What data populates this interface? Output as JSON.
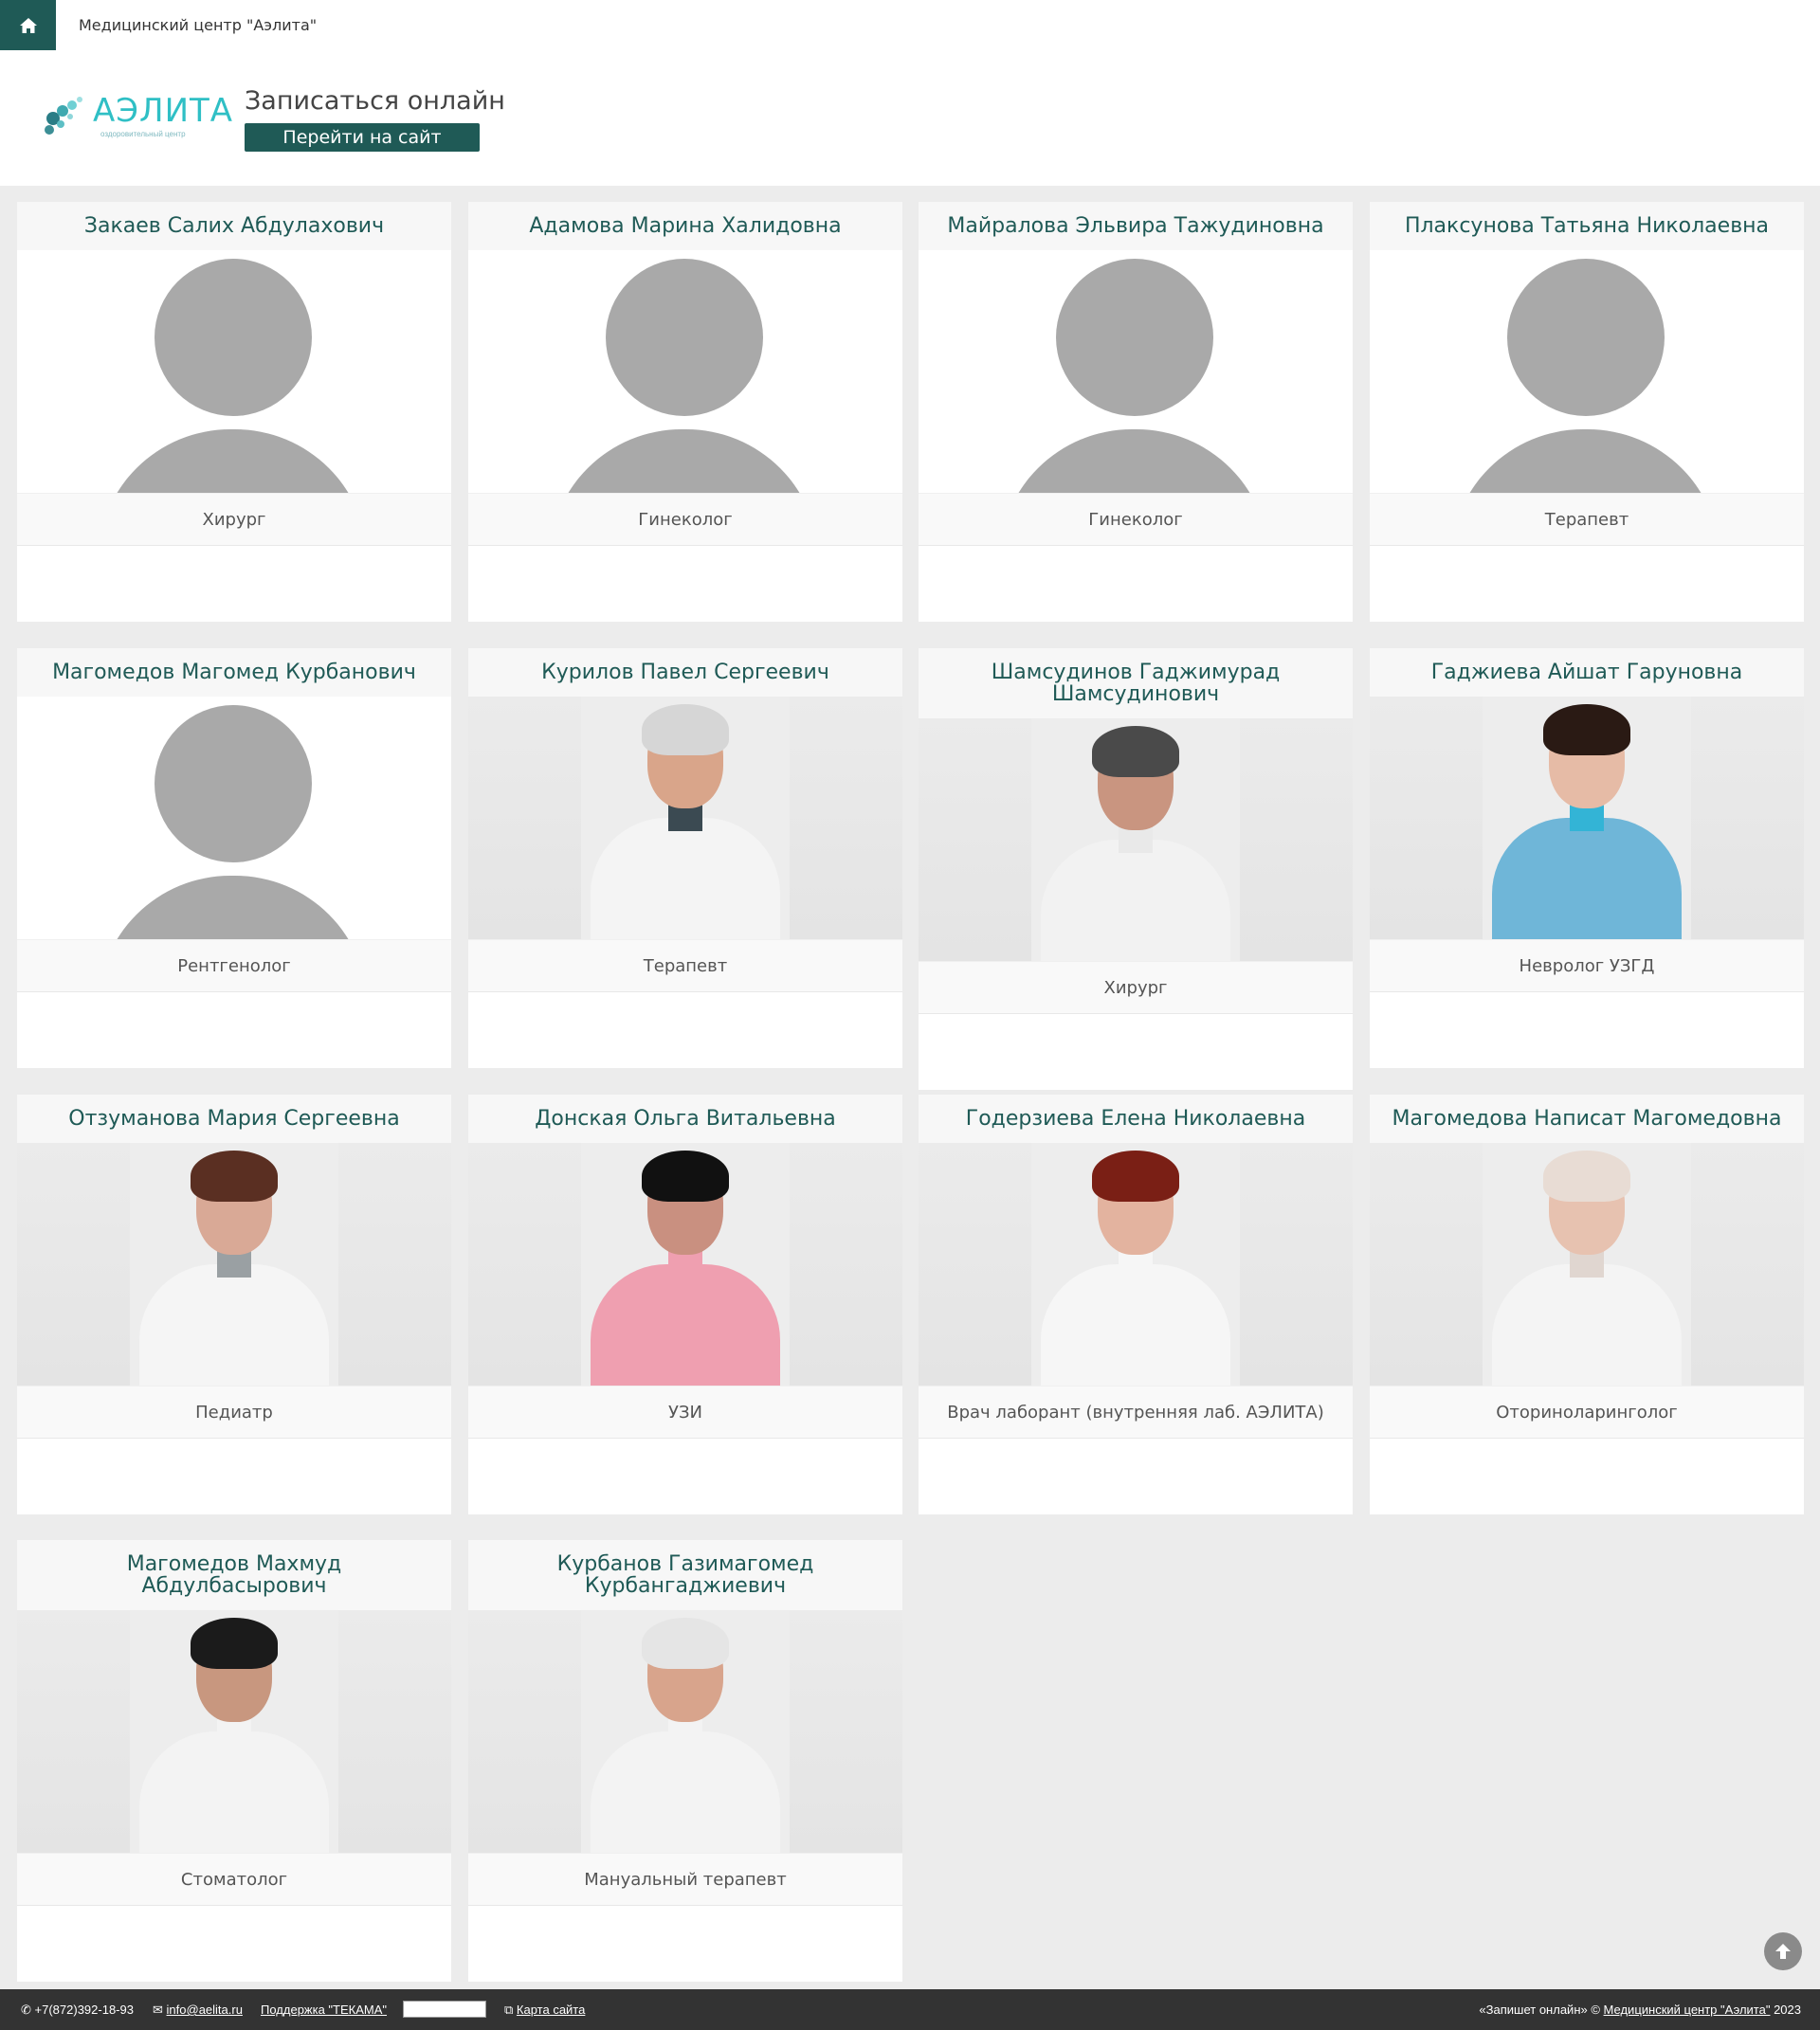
{
  "topbar": {
    "home_icon": "home-icon",
    "site_name": "Медицинский центр \"Аэлита\""
  },
  "header": {
    "logo_text": "АЭЛИТА",
    "logo_sub": "оздоровительный центр",
    "booking_title": "Записаться онлайн",
    "site_button": "Перейти на сайт"
  },
  "doctors": [
    {
      "name": "Закаев Салих Абдулахович",
      "specialty": "Хирург",
      "photo": "placeholder"
    },
    {
      "name": "Адамова Марина Халидовна",
      "specialty": "Гинеколог",
      "photo": "placeholder"
    },
    {
      "name": "Майралова Эльвира Тажудиновна",
      "specialty": "Гинеколог",
      "photo": "placeholder"
    },
    {
      "name": "Плаксунова Татьяна Николаевна",
      "specialty": "Терапевт",
      "photo": "placeholder"
    },
    {
      "name": "Магомедов Магомед Курбанович",
      "specialty": "Рентгенолог",
      "photo": "placeholder"
    },
    {
      "name": "Курилов Павел Сергеевич",
      "specialty": "Терапевт",
      "photo": "photo"
    },
    {
      "name": "Шамсудинов Гаджимурад Шамсудинович",
      "specialty": "Хирург",
      "photo": "photo"
    },
    {
      "name": "Гаджиева Айшат Гаруновна",
      "specialty": "Невролог УЗГД",
      "photo": "photo"
    },
    {
      "name": "Отзуманова Мария Сергеевна",
      "specialty": "Педиатр",
      "photo": "photo"
    },
    {
      "name": "Донская Ольга Витальевна",
      "specialty": "УЗИ",
      "photo": "photo"
    },
    {
      "name": "Годерзиева Елена Николаевна",
      "specialty": "Врач лаборант (внутренняя лаб. АЭЛИТА)",
      "photo": "photo"
    },
    {
      "name": "Магомедова Написат Магомедовна",
      "specialty": "Оториноларинголог",
      "photo": "photo"
    },
    {
      "name": "Магомедов Махмуд Абдулбасырович",
      "specialty": "Стоматолог",
      "photo": "photo"
    },
    {
      "name": "Курбанов Газимагомед Курбангаджиевич",
      "specialty": "Мануальный терапевт",
      "photo": "photo"
    }
  ],
  "footer": {
    "phone": "+7(872)392-18-93",
    "email": "info@aelita.ru",
    "support": "Поддержка \"ТЕКАМА\"",
    "sitemap": "Карта сайта",
    "copyright_prefix": "«Запишет онлайн» ©",
    "copyright_link": "Медицинский центр \"Аэлита\"",
    "copyright_year": "2023"
  },
  "colors": {
    "brand_dark": "#1f5a56",
    "brand_cyan": "#2fbfc5",
    "page_bg": "#ececec",
    "footer_bg": "#333333"
  }
}
